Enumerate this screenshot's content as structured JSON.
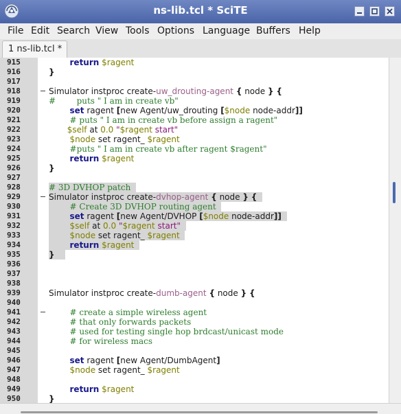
{
  "window": {
    "title": "ns-lib.tcl * SciTE",
    "icons": [
      "scite-app-icon",
      "minimize-icon",
      "maximize-icon",
      "close-icon"
    ]
  },
  "menu": [
    "File",
    "Edit",
    "Search",
    "View",
    "Tools",
    "Options",
    "Language",
    "Buffers",
    "Help"
  ],
  "tabs": [
    {
      "label": "1 ns-lib.tcl *",
      "active": true
    }
  ],
  "colors": {
    "titlebar": "#5570b5",
    "keyword": "#1a1a8c",
    "variable": "#7f7f00",
    "comment": "#2d7d2d",
    "string": "#8b1a7a",
    "selection": "#d6d6d6",
    "gutter": "#d9d9d9"
  },
  "editor": {
    "lines": [
      {
        "num": "915",
        "fold": false,
        "sel": false,
        "tokens": [
          [
            "",
            "        "
          ],
          [
            "k",
            "return"
          ],
          [
            "",
            " "
          ],
          [
            "v",
            "$ragent"
          ]
        ]
      },
      {
        "num": "916",
        "fold": false,
        "sel": false,
        "tokens": [
          [
            "pu",
            "}"
          ]
        ]
      },
      {
        "num": "917",
        "fold": false,
        "sel": false,
        "tokens": []
      },
      {
        "num": "918",
        "fold": true,
        "sel": false,
        "tokens": [
          [
            "tx",
            "Simulator instproc create-"
          ],
          [
            "nm",
            "uw_drouting-agent"
          ],
          [
            "",
            " "
          ],
          [
            "pu",
            "{"
          ],
          [
            "",
            " node "
          ],
          [
            "pu",
            "}"
          ],
          [
            "",
            " "
          ],
          [
            "pu",
            "{"
          ]
        ]
      },
      {
        "num": "919",
        "fold": false,
        "sel": false,
        "tokens": [
          [
            "cm",
            "#        puts \" I am in create vb\""
          ]
        ]
      },
      {
        "num": "920",
        "fold": false,
        "sel": false,
        "tokens": [
          [
            "",
            "        "
          ],
          [
            "k",
            "set"
          ],
          [
            "",
            " ragent "
          ],
          [
            "pu",
            "["
          ],
          [
            "",
            "new Agent/uw_drouting "
          ],
          [
            "pu",
            "["
          ],
          [
            "v",
            "$node"
          ],
          [
            "",
            " node-addr"
          ],
          [
            "pu",
            "]]"
          ]
        ]
      },
      {
        "num": "921",
        "fold": false,
        "sel": false,
        "tokens": [
          [
            "",
            "        "
          ],
          [
            "cm",
            "# puts \" I am in create vb before assign a ragent\""
          ]
        ]
      },
      {
        "num": "922",
        "fold": false,
        "sel": false,
        "tokens": [
          [
            "",
            "       "
          ],
          [
            "v",
            "$self"
          ],
          [
            "",
            " at "
          ],
          [
            "v",
            "0.0"
          ],
          [
            "",
            " "
          ],
          [
            "st",
            "\""
          ],
          [
            "v",
            "$ragent"
          ],
          [
            "st",
            " start\""
          ]
        ]
      },
      {
        "num": "923",
        "fold": false,
        "sel": false,
        "tokens": [
          [
            "",
            "        "
          ],
          [
            "v",
            "$node"
          ],
          [
            "",
            " set ragent_ "
          ],
          [
            "v",
            "$ragent"
          ]
        ]
      },
      {
        "num": "924",
        "fold": false,
        "sel": false,
        "tokens": [
          [
            "",
            "        "
          ],
          [
            "cm",
            "#puts \" I am in create vb after ragent $ragent\""
          ]
        ]
      },
      {
        "num": "925",
        "fold": false,
        "sel": false,
        "tokens": [
          [
            "",
            "        "
          ],
          [
            "k",
            "return"
          ],
          [
            "",
            " "
          ],
          [
            "v",
            "$ragent"
          ]
        ]
      },
      {
        "num": "926",
        "fold": false,
        "sel": false,
        "tokens": [
          [
            "pu",
            "}"
          ]
        ]
      },
      {
        "num": "927",
        "fold": false,
        "sel": false,
        "tokens": []
      },
      {
        "num": "928",
        "fold": false,
        "sel": true,
        "tokens": [
          [
            "cm",
            "# 3D DVHOP patch"
          ],
          [
            "",
            "  "
          ]
        ]
      },
      {
        "num": "929",
        "fold": true,
        "sel": true,
        "tokens": [
          [
            "tx",
            "Simulator instproc create-"
          ],
          [
            "nm",
            "dvhop-agent"
          ],
          [
            "",
            " "
          ],
          [
            "pu",
            "{"
          ],
          [
            "",
            " node "
          ],
          [
            "pu",
            "}"
          ],
          [
            "",
            " "
          ],
          [
            "pu",
            "{"
          ],
          [
            "",
            "  "
          ]
        ]
      },
      {
        "num": "930",
        "fold": false,
        "sel": true,
        "tokens": [
          [
            "",
            "        "
          ],
          [
            "cm",
            "# Create 3D DVHOP routing agent"
          ],
          [
            "",
            "  "
          ]
        ]
      },
      {
        "num": "931",
        "fold": false,
        "sel": true,
        "tokens": [
          [
            "",
            "        "
          ],
          [
            "k",
            "set"
          ],
          [
            "",
            " ragent "
          ],
          [
            "pu",
            "["
          ],
          [
            "",
            "new Agent/DVHOP "
          ],
          [
            "pu",
            "["
          ],
          [
            "v",
            "$node"
          ],
          [
            "",
            " node-addr"
          ],
          [
            "pu",
            "]]"
          ],
          [
            "",
            "  "
          ]
        ]
      },
      {
        "num": "932",
        "fold": false,
        "sel": true,
        "tokens": [
          [
            "",
            "        "
          ],
          [
            "v",
            "$self"
          ],
          [
            "",
            " at "
          ],
          [
            "v",
            "0.0"
          ],
          [
            "",
            " "
          ],
          [
            "st",
            "\""
          ],
          [
            "v",
            "$ragent"
          ],
          [
            "st",
            " start\""
          ],
          [
            "",
            "  "
          ]
        ]
      },
      {
        "num": "933",
        "fold": false,
        "sel": true,
        "tokens": [
          [
            "",
            "        "
          ],
          [
            "v",
            "$node"
          ],
          [
            "",
            " set ragent_ "
          ],
          [
            "v",
            "$ragent"
          ],
          [
            "",
            "  "
          ]
        ]
      },
      {
        "num": "934",
        "fold": false,
        "sel": true,
        "tokens": [
          [
            "",
            "        "
          ],
          [
            "k",
            "return"
          ],
          [
            "",
            " "
          ],
          [
            "v",
            "$ragent"
          ],
          [
            "",
            "  "
          ]
        ]
      },
      {
        "num": "935",
        "fold": false,
        "sel": true,
        "tokens": [
          [
            "pu",
            "}"
          ],
          [
            "",
            "    "
          ]
        ]
      },
      {
        "num": "936",
        "fold": false,
        "sel": false,
        "tokens": []
      },
      {
        "num": "937",
        "fold": false,
        "sel": false,
        "tokens": []
      },
      {
        "num": "938",
        "fold": false,
        "sel": false,
        "tokens": []
      },
      {
        "num": "939",
        "fold": false,
        "sel": false,
        "tokens": [
          [
            "tx",
            "Simulator instproc create-"
          ],
          [
            "nm",
            "dumb-agent"
          ],
          [
            "",
            " "
          ],
          [
            "pu",
            "{"
          ],
          [
            "",
            " node "
          ],
          [
            "pu",
            "}"
          ],
          [
            "",
            " "
          ],
          [
            "pu",
            "{"
          ]
        ]
      },
      {
        "num": "940",
        "fold": false,
        "sel": false,
        "tokens": []
      },
      {
        "num": "941",
        "fold": true,
        "sel": false,
        "tokens": [
          [
            "",
            "        "
          ],
          [
            "cm",
            "# create a simple wireless agent"
          ]
        ]
      },
      {
        "num": "942",
        "fold": false,
        "sel": false,
        "tokens": [
          [
            "",
            "        "
          ],
          [
            "cm",
            "# that only forwards packets"
          ]
        ]
      },
      {
        "num": "943",
        "fold": false,
        "sel": false,
        "tokens": [
          [
            "",
            "        "
          ],
          [
            "cm",
            "# used for testing single hop brdcast/unicast mode"
          ]
        ]
      },
      {
        "num": "944",
        "fold": false,
        "sel": false,
        "tokens": [
          [
            "",
            "        "
          ],
          [
            "cm",
            "# for wireless macs"
          ]
        ]
      },
      {
        "num": "945",
        "fold": false,
        "sel": false,
        "tokens": []
      },
      {
        "num": "946",
        "fold": false,
        "sel": false,
        "tokens": [
          [
            "",
            "        "
          ],
          [
            "k",
            "set"
          ],
          [
            "",
            " ragent "
          ],
          [
            "pu",
            "["
          ],
          [
            "",
            "new Agent/DumbAgent"
          ],
          [
            "pu",
            "]"
          ]
        ]
      },
      {
        "num": "947",
        "fold": false,
        "sel": false,
        "tokens": [
          [
            "",
            "        "
          ],
          [
            "v",
            "$node"
          ],
          [
            "",
            " set ragent_ "
          ],
          [
            "v",
            "$ragent"
          ]
        ]
      },
      {
        "num": "948",
        "fold": false,
        "sel": false,
        "tokens": []
      },
      {
        "num": "949",
        "fold": false,
        "sel": false,
        "tokens": [
          [
            "",
            "        "
          ],
          [
            "k",
            "return"
          ],
          [
            "",
            " "
          ],
          [
            "v",
            "$ragent"
          ]
        ]
      },
      {
        "num": "950",
        "fold": false,
        "sel": false,
        "tokens": [
          [
            "pu",
            "}"
          ]
        ]
      }
    ]
  }
}
